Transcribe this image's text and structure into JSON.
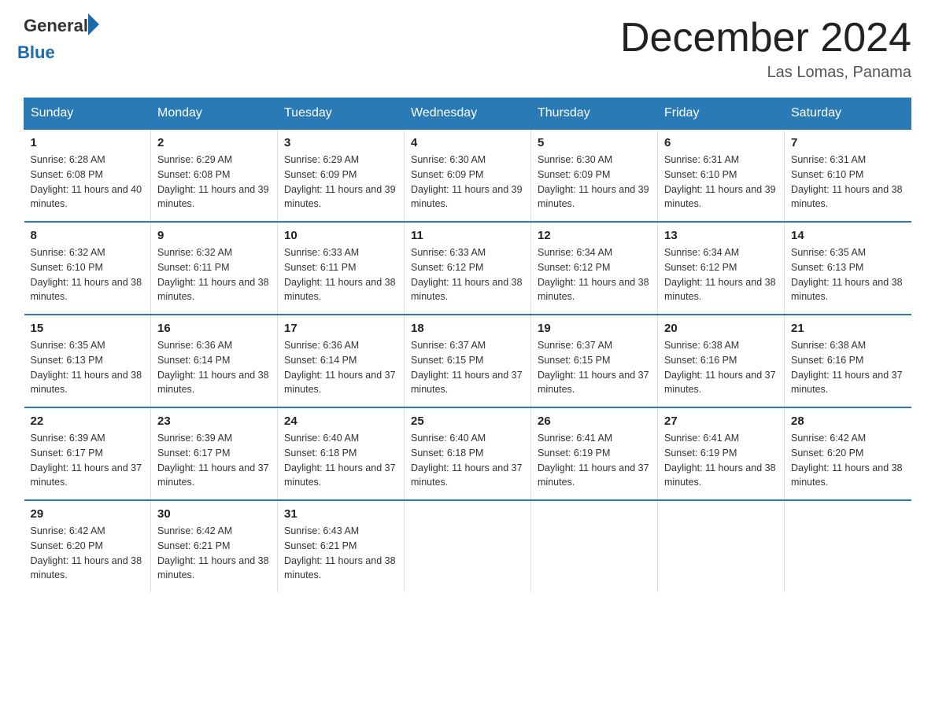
{
  "header": {
    "logo_general": "General",
    "logo_blue": "Blue",
    "title": "December 2024",
    "location": "Las Lomas, Panama"
  },
  "calendar": {
    "days_of_week": [
      "Sunday",
      "Monday",
      "Tuesday",
      "Wednesday",
      "Thursday",
      "Friday",
      "Saturday"
    ],
    "weeks": [
      [
        {
          "day": "1",
          "sunrise": "6:28 AM",
          "sunset": "6:08 PM",
          "daylight": "11 hours and 40 minutes."
        },
        {
          "day": "2",
          "sunrise": "6:29 AM",
          "sunset": "6:08 PM",
          "daylight": "11 hours and 39 minutes."
        },
        {
          "day": "3",
          "sunrise": "6:29 AM",
          "sunset": "6:09 PM",
          "daylight": "11 hours and 39 minutes."
        },
        {
          "day": "4",
          "sunrise": "6:30 AM",
          "sunset": "6:09 PM",
          "daylight": "11 hours and 39 minutes."
        },
        {
          "day": "5",
          "sunrise": "6:30 AM",
          "sunset": "6:09 PM",
          "daylight": "11 hours and 39 minutes."
        },
        {
          "day": "6",
          "sunrise": "6:31 AM",
          "sunset": "6:10 PM",
          "daylight": "11 hours and 39 minutes."
        },
        {
          "day": "7",
          "sunrise": "6:31 AM",
          "sunset": "6:10 PM",
          "daylight": "11 hours and 38 minutes."
        }
      ],
      [
        {
          "day": "8",
          "sunrise": "6:32 AM",
          "sunset": "6:10 PM",
          "daylight": "11 hours and 38 minutes."
        },
        {
          "day": "9",
          "sunrise": "6:32 AM",
          "sunset": "6:11 PM",
          "daylight": "11 hours and 38 minutes."
        },
        {
          "day": "10",
          "sunrise": "6:33 AM",
          "sunset": "6:11 PM",
          "daylight": "11 hours and 38 minutes."
        },
        {
          "day": "11",
          "sunrise": "6:33 AM",
          "sunset": "6:12 PM",
          "daylight": "11 hours and 38 minutes."
        },
        {
          "day": "12",
          "sunrise": "6:34 AM",
          "sunset": "6:12 PM",
          "daylight": "11 hours and 38 minutes."
        },
        {
          "day": "13",
          "sunrise": "6:34 AM",
          "sunset": "6:12 PM",
          "daylight": "11 hours and 38 minutes."
        },
        {
          "day": "14",
          "sunrise": "6:35 AM",
          "sunset": "6:13 PM",
          "daylight": "11 hours and 38 minutes."
        }
      ],
      [
        {
          "day": "15",
          "sunrise": "6:35 AM",
          "sunset": "6:13 PM",
          "daylight": "11 hours and 38 minutes."
        },
        {
          "day": "16",
          "sunrise": "6:36 AM",
          "sunset": "6:14 PM",
          "daylight": "11 hours and 38 minutes."
        },
        {
          "day": "17",
          "sunrise": "6:36 AM",
          "sunset": "6:14 PM",
          "daylight": "11 hours and 37 minutes."
        },
        {
          "day": "18",
          "sunrise": "6:37 AM",
          "sunset": "6:15 PM",
          "daylight": "11 hours and 37 minutes."
        },
        {
          "day": "19",
          "sunrise": "6:37 AM",
          "sunset": "6:15 PM",
          "daylight": "11 hours and 37 minutes."
        },
        {
          "day": "20",
          "sunrise": "6:38 AM",
          "sunset": "6:16 PM",
          "daylight": "11 hours and 37 minutes."
        },
        {
          "day": "21",
          "sunrise": "6:38 AM",
          "sunset": "6:16 PM",
          "daylight": "11 hours and 37 minutes."
        }
      ],
      [
        {
          "day": "22",
          "sunrise": "6:39 AM",
          "sunset": "6:17 PM",
          "daylight": "11 hours and 37 minutes."
        },
        {
          "day": "23",
          "sunrise": "6:39 AM",
          "sunset": "6:17 PM",
          "daylight": "11 hours and 37 minutes."
        },
        {
          "day": "24",
          "sunrise": "6:40 AM",
          "sunset": "6:18 PM",
          "daylight": "11 hours and 37 minutes."
        },
        {
          "day": "25",
          "sunrise": "6:40 AM",
          "sunset": "6:18 PM",
          "daylight": "11 hours and 37 minutes."
        },
        {
          "day": "26",
          "sunrise": "6:41 AM",
          "sunset": "6:19 PM",
          "daylight": "11 hours and 37 minutes."
        },
        {
          "day": "27",
          "sunrise": "6:41 AM",
          "sunset": "6:19 PM",
          "daylight": "11 hours and 38 minutes."
        },
        {
          "day": "28",
          "sunrise": "6:42 AM",
          "sunset": "6:20 PM",
          "daylight": "11 hours and 38 minutes."
        }
      ],
      [
        {
          "day": "29",
          "sunrise": "6:42 AM",
          "sunset": "6:20 PM",
          "daylight": "11 hours and 38 minutes."
        },
        {
          "day": "30",
          "sunrise": "6:42 AM",
          "sunset": "6:21 PM",
          "daylight": "11 hours and 38 minutes."
        },
        {
          "day": "31",
          "sunrise": "6:43 AM",
          "sunset": "6:21 PM",
          "daylight": "11 hours and 38 minutes."
        },
        null,
        null,
        null,
        null
      ]
    ]
  }
}
